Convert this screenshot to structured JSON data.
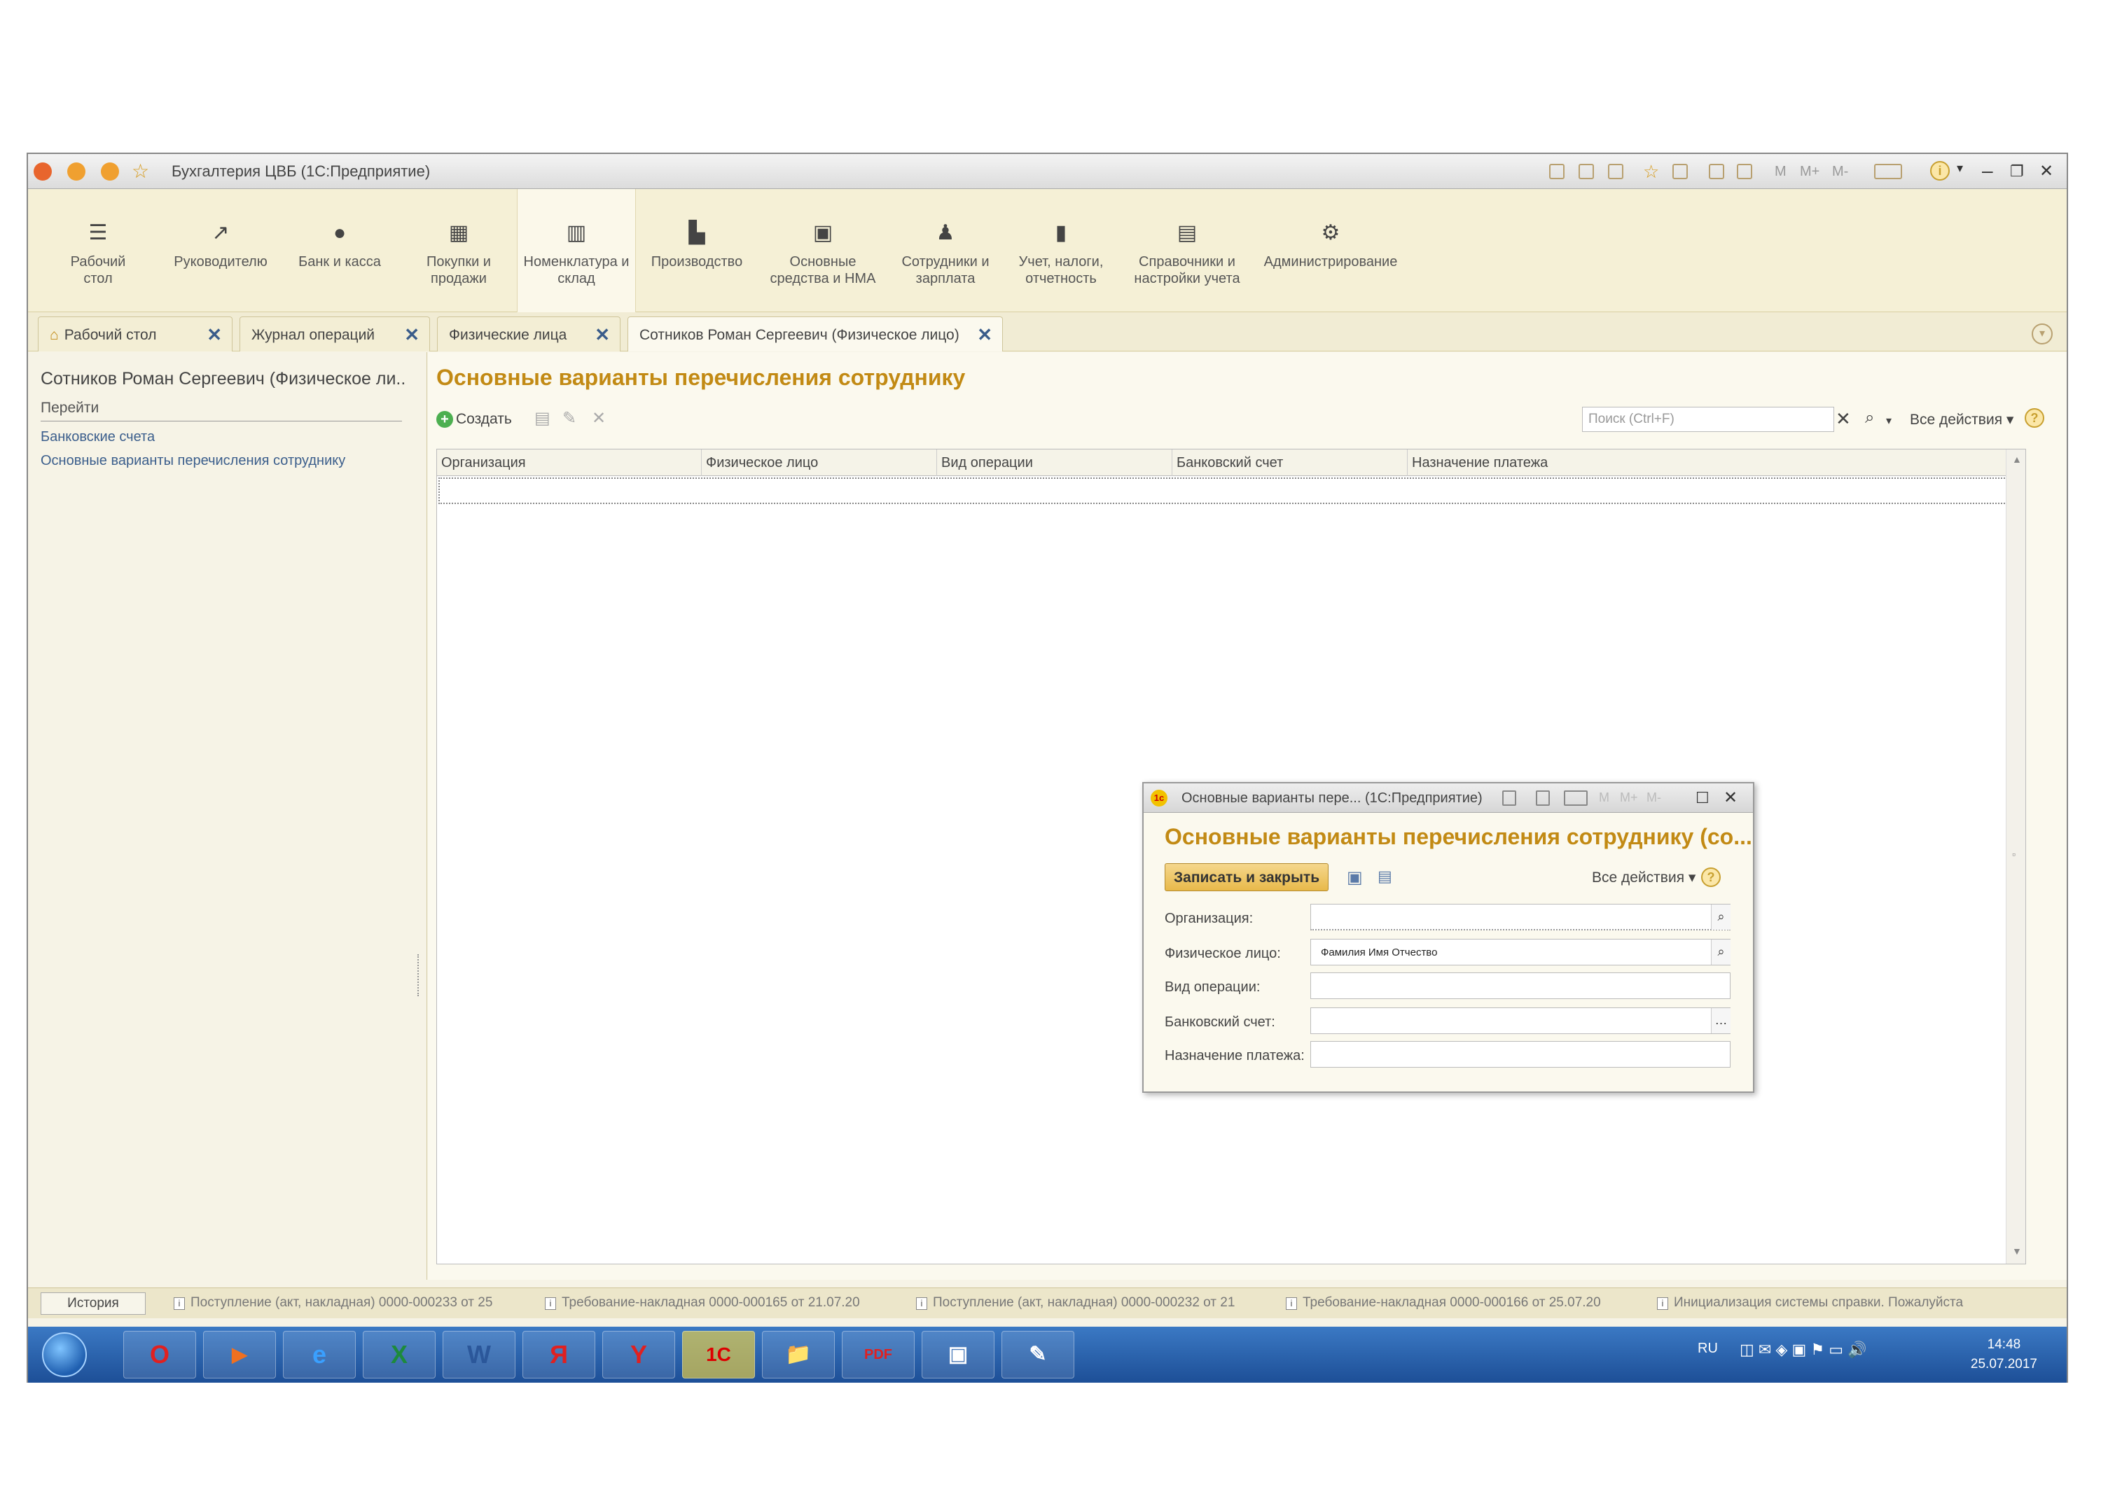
{
  "window": {
    "title": "Бухгалтерия ЦВБ (1С:Предприятие)",
    "toolbar_text": [
      "M",
      "M+",
      "M-"
    ]
  },
  "sections": [
    {
      "icon": "menu-icon",
      "label": "Рабочий стол"
    },
    {
      "icon": "chart-icon",
      "label": "Руководителю"
    },
    {
      "icon": "bank-icon",
      "label": "Банк и касса"
    },
    {
      "icon": "cart-icon",
      "label": "Покупки и продажи"
    },
    {
      "icon": "warehouse-icon",
      "label": "Номенклатура и склад"
    },
    {
      "icon": "factory-icon",
      "label": "Производство"
    },
    {
      "icon": "truck-icon",
      "label": "Основные средства и НМА"
    },
    {
      "icon": "person-icon",
      "label": "Сотрудники и зарплата"
    },
    {
      "icon": "bar-chart-icon",
      "label": "Учет, налоги, отчетность"
    },
    {
      "icon": "book-icon",
      "label": "Справочники и настройки учета"
    },
    {
      "icon": "gear-icon",
      "label": "Администрирование"
    }
  ],
  "tabs": [
    {
      "label": "Рабочий стол"
    },
    {
      "label": "Журнал операций"
    },
    {
      "label": "Физические лица"
    },
    {
      "label": "Сотников Роман Сергеевич (Физическое лицо)"
    }
  ],
  "left_pane": {
    "title": "Сотников Роман Сергеевич (Физическое ли...",
    "goto": "Перейти",
    "links": [
      "Банковские счета",
      "Основные варианты перечисления сотруднику"
    ]
  },
  "main": {
    "title": "Основные варианты перечисления сотруднику",
    "create_label": "Создать",
    "search_placeholder": "Поиск (Ctrl+F)",
    "all_actions": "Все действия",
    "columns": [
      "Организация",
      "Физическое лицо",
      "Вид операции",
      "Банковский счет",
      "Назначение платежа"
    ]
  },
  "dialog": {
    "window_title": "Основные варианты пере... (1С:Предприятие)",
    "window_text": [
      "M",
      "M+",
      "M-"
    ],
    "title": "Основные варианты перечисления сотруднику (со...",
    "save_close": "Записать и закрыть",
    "all_actions": "Все действия",
    "fields": [
      {
        "label": "Организация:",
        "value": ""
      },
      {
        "label": "Физическое лицо:",
        "value": "Фамилия Имя Отчество"
      },
      {
        "label": "Вид операции:",
        "value": ""
      },
      {
        "label": "Банковский счет:",
        "value": ""
      },
      {
        "label": "Назначение платежа:",
        "value": ""
      }
    ]
  },
  "history": {
    "button": "История",
    "items": [
      "Поступление (акт, накладная) 0000-000233 от 25",
      "Требование-накладная 0000-000165 от 21.07.20",
      "Поступление (акт, накладная) 0000-000232 от 21",
      "Требование-накладная 0000-000166 от 25.07.20",
      "Инициализация системы справки. Пожалуйста"
    ]
  },
  "taskbar": {
    "apps": [
      "O",
      "▶",
      "e",
      "X",
      "W",
      "Я",
      "Y",
      "1С",
      "📁",
      "PDF",
      "▣",
      "✎"
    ],
    "lang": "RU",
    "time": "14:48",
    "date": "25.07.2017"
  },
  "colors": {
    "accent": "#c28a14",
    "panel": "#f5f0d6",
    "taskbar": "#2a62ad"
  }
}
